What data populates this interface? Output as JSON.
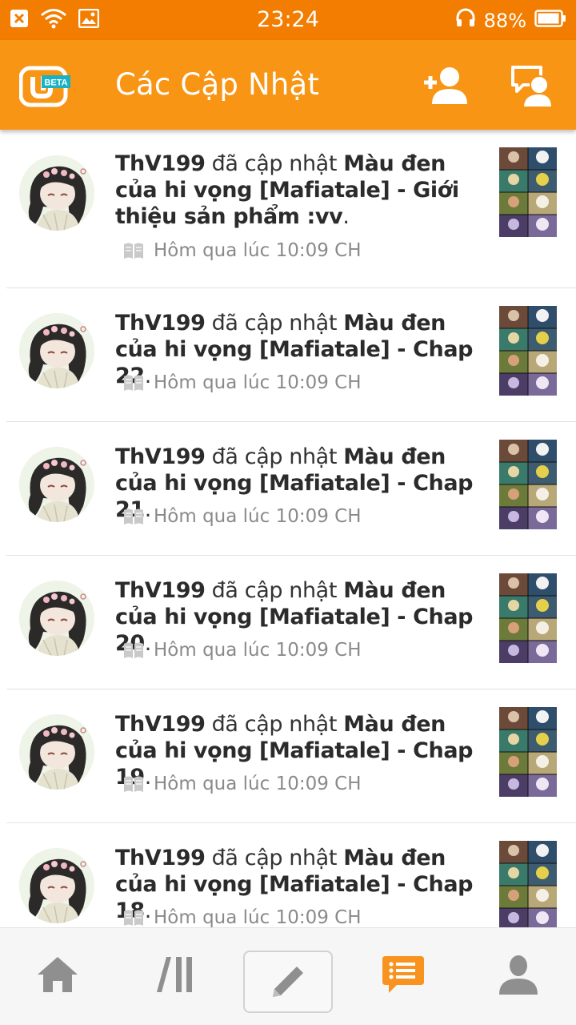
{
  "status_bar": {
    "time": "23:24",
    "battery": "88%",
    "icons": [
      "close-box-icon",
      "wifi-icon",
      "image-icon",
      "headset-icon",
      "battery-icon"
    ]
  },
  "header": {
    "title": "Các Cập Nhật",
    "logo_badge": "BETA"
  },
  "feed": {
    "items": [
      {
        "user": "ThV199",
        "action": " đã cập nhật ",
        "story": "Màu đen của hi vọng [Mafiatale] - Giới thiệu sản phẩm :vv",
        "end": ".",
        "time": "Hôm qua lúc 10:09 CH"
      },
      {
        "user": "ThV199",
        "action": " đã cập nhật ",
        "story": "Màu đen của hi vọng [Mafiatale] - Chap 22",
        "end": ".",
        "time": "Hôm qua lúc 10:09 CH"
      },
      {
        "user": "ThV199",
        "action": " đã cập nhật ",
        "story": "Màu đen của hi vọng [Mafiatale] - Chap 21",
        "end": ".",
        "time": "Hôm qua lúc 10:09 CH"
      },
      {
        "user": "ThV199",
        "action": " đã cập nhật ",
        "story": "Màu đen của hi vọng [Mafiatale] - Chap 20",
        "end": ".",
        "time": "Hôm qua lúc 10:09 CH"
      },
      {
        "user": "ThV199",
        "action": " đã cập nhật ",
        "story": "Màu đen của hi vọng [Mafiatale] - Chap 19",
        "end": ".",
        "time": "Hôm qua lúc 10:09 CH"
      },
      {
        "user": "ThV199",
        "action": " đã cập nhật ",
        "story": "Màu đen của hi vọng [Mafiatale] - Chap 18",
        "end": ".",
        "time": "Hôm qua lúc 10:09 CH"
      }
    ]
  },
  "bottom_nav": {
    "items": [
      "home-icon",
      "library-icon",
      "write-icon",
      "updates-icon",
      "profile-icon"
    ],
    "active": "updates-icon"
  },
  "colors": {
    "status_bar": "#f27d00",
    "app_bar": "#f89514",
    "accent": "#f7931e",
    "nav_icon": "#8f8f8f"
  }
}
